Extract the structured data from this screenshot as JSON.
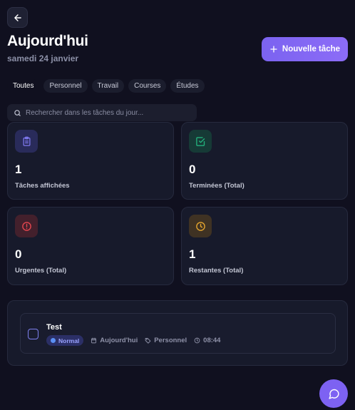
{
  "header": {
    "title": "Aujourd'hui",
    "date": "samedi 24 janvier",
    "new_task_label": "Nouvelle tâche"
  },
  "filters": [
    "Toutes",
    "Personnel",
    "Travail",
    "Courses",
    "Études"
  ],
  "active_filter": "Toutes",
  "search": {
    "placeholder": "Rechercher dans les tâches du jour...",
    "value": ""
  },
  "stats": [
    {
      "value": "1",
      "label": "Tâches affichées",
      "icon": "clipboard-icon",
      "color": "#6f67e6"
    },
    {
      "value": "0",
      "label": "Terminées (Total)",
      "icon": "check-square-icon",
      "color": "#22b07a"
    },
    {
      "value": "0",
      "label": "Urgentes (Total)",
      "icon": "alert-circle-icon",
      "color": "#e0444e"
    },
    {
      "value": "1",
      "label": "Restantes (Total)",
      "icon": "clock-icon",
      "color": "#e2a22d"
    }
  ],
  "tasks": [
    {
      "title": "Test",
      "priority": "Normal",
      "due": "Aujourd'hui",
      "category": "Personnel",
      "time": "08:44",
      "completed": false
    }
  ],
  "colors": {
    "background": "#10101f",
    "accent": "#7b63f0",
    "card": "#171a2b"
  }
}
